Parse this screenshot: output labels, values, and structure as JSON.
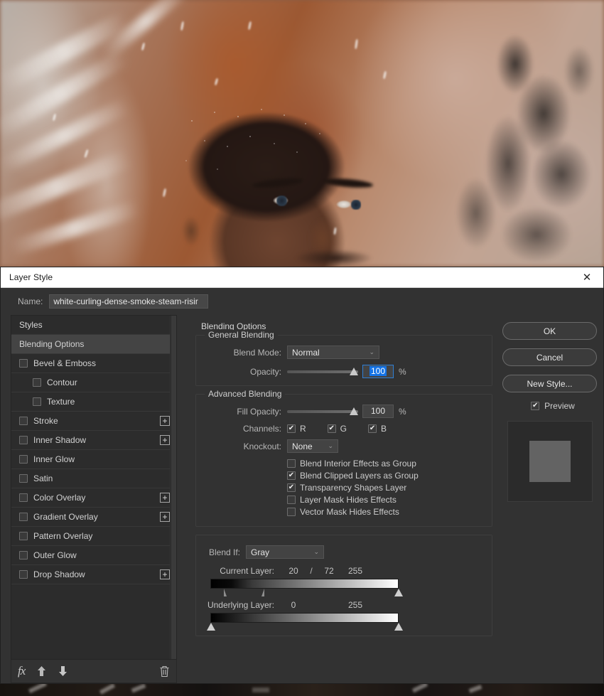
{
  "photo": {
    "description": "close-up portrait of a man with snow in his hair, blurred warm orange background, dark smoke on right"
  },
  "dialog": {
    "title": "Layer Style",
    "close_icon": "close-icon",
    "name_label": "Name:",
    "name_value": "white-curling-dense-smoke-steam-risir"
  },
  "styles_panel": {
    "header": "Styles",
    "items": [
      {
        "label": "Blending Options",
        "selected": true,
        "checkbox": false,
        "checked": false,
        "plus": false,
        "sub": false
      },
      {
        "label": "Bevel & Emboss",
        "selected": false,
        "checkbox": true,
        "checked": false,
        "plus": false,
        "sub": false
      },
      {
        "label": "Contour",
        "selected": false,
        "checkbox": true,
        "checked": false,
        "plus": false,
        "sub": true
      },
      {
        "label": "Texture",
        "selected": false,
        "checkbox": true,
        "checked": false,
        "plus": false,
        "sub": true
      },
      {
        "label": "Stroke",
        "selected": false,
        "checkbox": true,
        "checked": false,
        "plus": true,
        "sub": false
      },
      {
        "label": "Inner Shadow",
        "selected": false,
        "checkbox": true,
        "checked": false,
        "plus": true,
        "sub": false
      },
      {
        "label": "Inner Glow",
        "selected": false,
        "checkbox": true,
        "checked": false,
        "plus": false,
        "sub": false
      },
      {
        "label": "Satin",
        "selected": false,
        "checkbox": true,
        "checked": false,
        "plus": false,
        "sub": false
      },
      {
        "label": "Color Overlay",
        "selected": false,
        "checkbox": true,
        "checked": false,
        "plus": true,
        "sub": false
      },
      {
        "label": "Gradient Overlay",
        "selected": false,
        "checkbox": true,
        "checked": false,
        "plus": true,
        "sub": false
      },
      {
        "label": "Pattern Overlay",
        "selected": false,
        "checkbox": true,
        "checked": false,
        "plus": false,
        "sub": false
      },
      {
        "label": "Outer Glow",
        "selected": false,
        "checkbox": true,
        "checked": false,
        "plus": false,
        "sub": false
      },
      {
        "label": "Drop Shadow",
        "selected": false,
        "checkbox": true,
        "checked": false,
        "plus": true,
        "sub": false
      }
    ],
    "footer_icons": [
      "fx-icon",
      "move-up-icon",
      "move-down-icon",
      "delete-icon"
    ],
    "fx_glyph": "fx"
  },
  "options": {
    "panel_title": "Blending Options",
    "general_blending": {
      "legend": "General Blending",
      "blend_mode_label": "Blend Mode:",
      "blend_mode_value": "Normal",
      "opacity_label": "Opacity:",
      "opacity_value": "100",
      "opacity_unit": "%",
      "opacity_percent": 100
    },
    "advanced_blending": {
      "legend": "Advanced Blending",
      "fill_opacity_label": "Fill Opacity:",
      "fill_opacity_value": "100",
      "fill_opacity_unit": "%",
      "fill_opacity_percent": 100,
      "channels_label": "Channels:",
      "channels": [
        {
          "label": "R",
          "checked": true
        },
        {
          "label": "G",
          "checked": true
        },
        {
          "label": "B",
          "checked": true
        }
      ],
      "knockout_label": "Knockout:",
      "knockout_value": "None",
      "checkboxes": [
        {
          "label": "Blend Interior Effects as Group",
          "checked": false
        },
        {
          "label": "Blend Clipped Layers as Group",
          "checked": true
        },
        {
          "label": "Transparency Shapes Layer",
          "checked": true
        },
        {
          "label": "Layer Mask Hides Effects",
          "checked": false
        },
        {
          "label": "Vector Mask Hides Effects",
          "checked": false
        }
      ]
    },
    "blend_if": {
      "label": "Blend If:",
      "channel_value": "Gray",
      "current_layer": {
        "title": "Current Layer:",
        "black_value": "20",
        "separator": "/",
        "black_split_value": "72",
        "white_value": "255",
        "black_pos_percent": 7.8,
        "black_split_pos_percent": 28.2,
        "white_pos_percent": 100
      },
      "underlying_layer": {
        "title": "Underlying Layer:",
        "black_value": "0",
        "white_value": "255",
        "black_pos_percent": 0,
        "white_pos_percent": 100
      }
    }
  },
  "buttons": {
    "ok": "OK",
    "cancel": "Cancel",
    "new_style": "New Style...",
    "preview_label": "Preview",
    "preview_checked": true
  },
  "icons": {
    "check": "✔",
    "caret_down": "⌄",
    "plus": "+",
    "close": "✕",
    "arrow_up": "⬆",
    "arrow_down": "⬇",
    "trash": "🗑"
  },
  "colors": {
    "panel_bg": "#323232",
    "list_bg": "#2c2c2c",
    "selected_row": "#444444",
    "accent_blue": "#1473e6",
    "focus_border": "#2f7fd4",
    "titlebar_bg": "#ffffff"
  }
}
